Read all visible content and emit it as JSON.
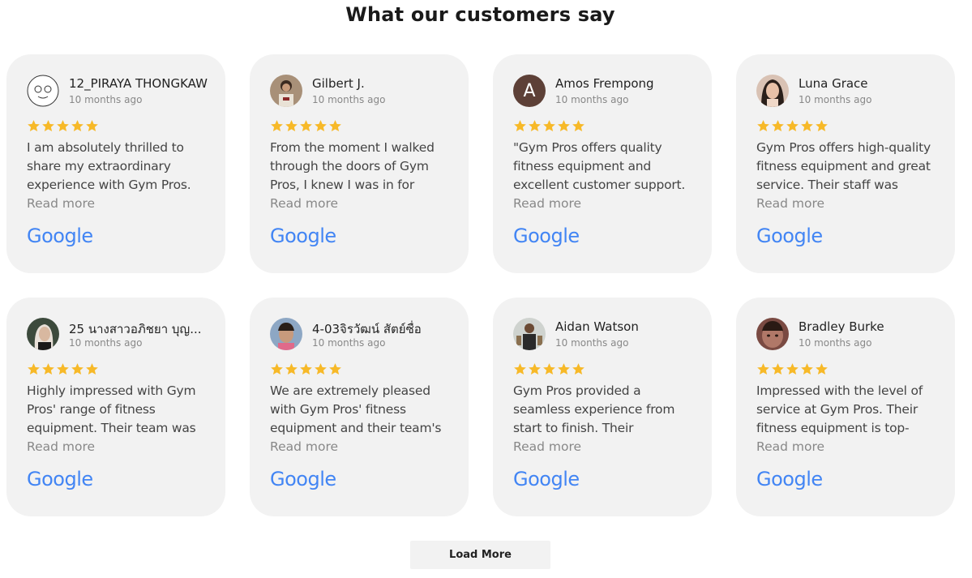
{
  "section_title": "What our customers say",
  "star_color": "#f7b928",
  "google_color": "#4285f4",
  "reviews": [
    {
      "name": "12_PIRAYA THONGKAW",
      "date": "10 months ago",
      "rating": 5,
      "avatar": "photo-avatar",
      "text": "I am absolutely thrilled to share my extraordinary experience with Gym Pros.",
      "read_more": "Read more",
      "source": "Google"
    },
    {
      "name": "Gilbert J.",
      "date": "10 months ago",
      "rating": 5,
      "avatar": "photo-avatar",
      "text": "From the moment I walked through the doors of Gym Pros, I knew I was in for",
      "read_more": "Read more",
      "source": "Google"
    },
    {
      "name": "Amos Frempong",
      "date": "10 months ago",
      "rating": 5,
      "avatar": "letter-avatar",
      "avatar_letter": "A",
      "text": "\"Gym Pros offers quality fitness equipment and excellent customer support.",
      "read_more": "Read more",
      "source": "Google"
    },
    {
      "name": "Luna Grace",
      "date": "10 months ago",
      "rating": 5,
      "avatar": "photo-avatar",
      "text": "Gym Pros offers high-quality fitness equipment and great service. Their staff was",
      "read_more": "Read more",
      "source": "Google"
    },
    {
      "name": "25 นางสาวอภิชยา บุญ...",
      "date": "10 months ago",
      "rating": 5,
      "avatar": "photo-avatar",
      "text": "Highly impressed with Gym Pros' range of fitness equipment. Their team was",
      "read_more": "Read more",
      "source": "Google"
    },
    {
      "name": "4-03จิรวัฒน์ สัตย์ซื่อ",
      "date": "10 months ago",
      "rating": 5,
      "avatar": "photo-avatar",
      "text": "We are extremely pleased with Gym Pros' fitness equipment and their team's",
      "read_more": "Read more",
      "source": "Google"
    },
    {
      "name": "Aidan Watson",
      "date": "10 months ago",
      "rating": 5,
      "avatar": "photo-avatar",
      "text": "Gym Pros provided a seamless experience from start to finish. Their selection",
      "read_more": "Read more",
      "source": "Google"
    },
    {
      "name": "Bradley Burke",
      "date": "10 months ago",
      "rating": 5,
      "avatar": "photo-avatar",
      "text": "Impressed with the level of service at Gym Pros. Their fitness equipment is top-",
      "read_more": "Read more",
      "source": "Google"
    }
  ],
  "load_more_label": "Load More"
}
